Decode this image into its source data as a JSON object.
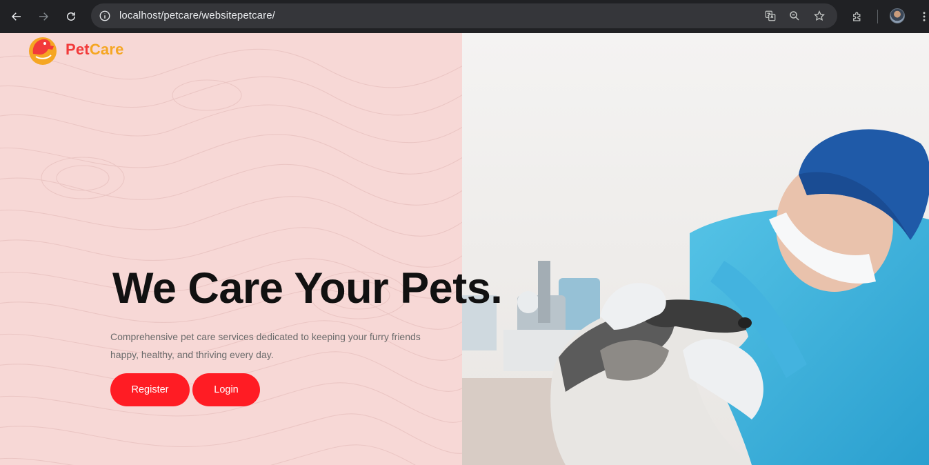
{
  "browser": {
    "url": "localhost/petcare/websitepetcare/",
    "icons": [
      "back-icon",
      "forward-icon",
      "reload-icon",
      "site-info-icon",
      "translate-icon",
      "zoom-icon",
      "bookmark-star-icon",
      "extensions-icon",
      "profile-avatar",
      "menu-kebab-icon"
    ]
  },
  "brand": {
    "name_part1": "Pet",
    "name_part2": "Care",
    "color_primary": "#f23a3a",
    "color_secondary": "#f5a623"
  },
  "hero": {
    "title": "We Care Your Pets.",
    "description": "Comprehensive pet care services dedicated to keeping your furry friends happy, healthy, and thriving every day.",
    "register_label": "Register",
    "login_label": "Login",
    "button_color": "#ff1c24",
    "background_color": "#f7d8d6"
  }
}
